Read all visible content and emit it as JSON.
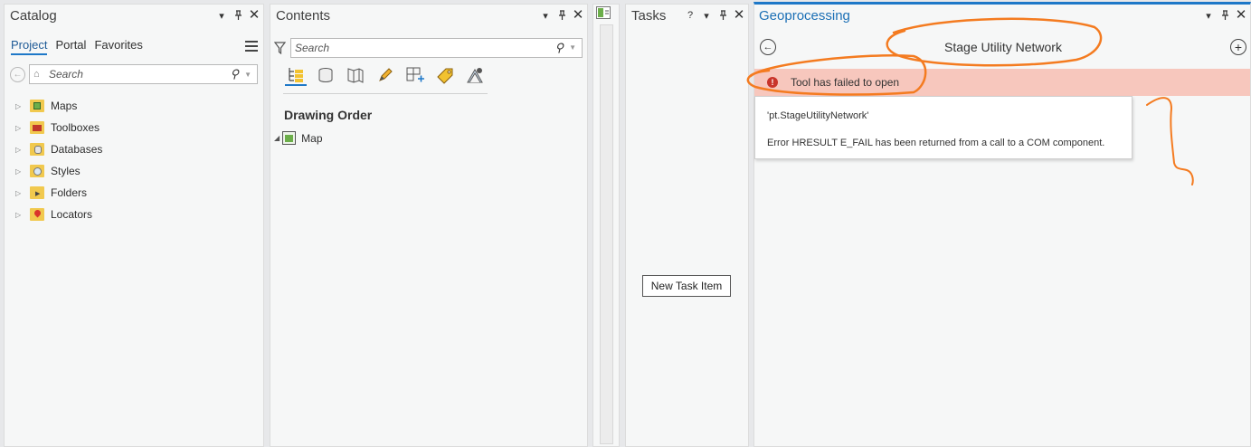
{
  "catalog": {
    "title": "Catalog",
    "tabs": [
      "Project",
      "Portal",
      "Favorites"
    ],
    "search_placeholder": "Search",
    "items": [
      {
        "label": "Maps",
        "icon": "maps-folder-icon"
      },
      {
        "label": "Toolboxes",
        "icon": "toolbox-folder-icon"
      },
      {
        "label": "Databases",
        "icon": "database-folder-icon"
      },
      {
        "label": "Styles",
        "icon": "styles-folder-icon"
      },
      {
        "label": "Folders",
        "icon": "folder-icon"
      },
      {
        "label": "Locators",
        "icon": "locator-folder-icon"
      }
    ]
  },
  "contents": {
    "title": "Contents",
    "search_placeholder": "Search",
    "section_title": "Drawing Order",
    "map_label": "Map"
  },
  "tasks": {
    "title": "Tasks",
    "new_task_label": "New Task Item",
    "help_glyph": "?"
  },
  "geoprocessing": {
    "title": "Geoprocessing",
    "tool_title": "Stage Utility Network",
    "error_message": "Tool has failed to open",
    "error_detail_line1": "'pt.StageUtilityNetwork'",
    "error_detail_line2": "Error HRESULT E_FAIL has been returned from a call to a COM component."
  },
  "colors": {
    "accent": "#1e78c8",
    "error_bg": "#f7c7bd",
    "annotation": "#f47b20"
  }
}
